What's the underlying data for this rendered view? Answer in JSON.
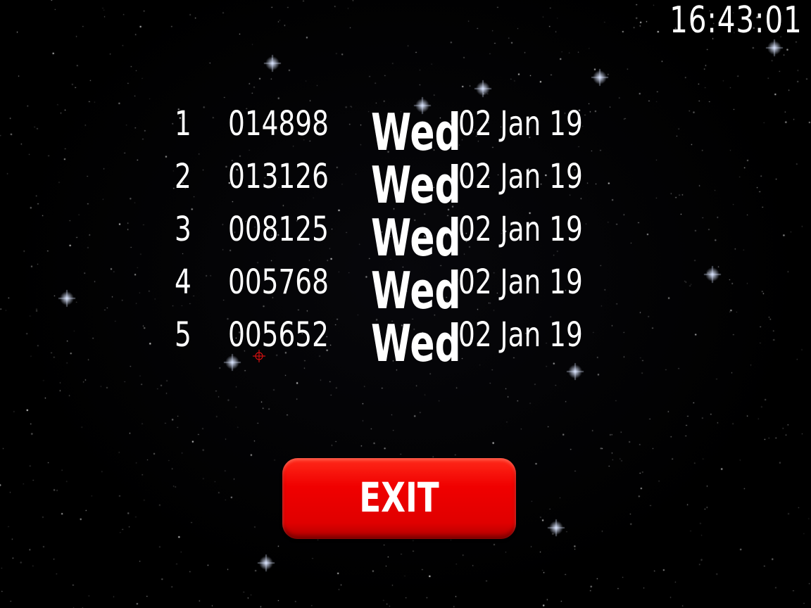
{
  "clock": "16:43:01",
  "high_scores": [
    {
      "rank": "1",
      "score": "014898",
      "day": "Wed",
      "date": "02 Jan 19"
    },
    {
      "rank": "2",
      "score": "013126",
      "day": "Wed",
      "date": "02 Jan 19"
    },
    {
      "rank": "3",
      "score": "008125",
      "day": "Wed",
      "date": "02 Jan 19"
    },
    {
      "rank": "4",
      "score": "005768",
      "day": "Wed",
      "date": "02 Jan 19"
    },
    {
      "rank": "5",
      "score": "005652",
      "day": "Wed",
      "date": "02 Jan 19"
    }
  ],
  "exit_button": {
    "label": "EXIT",
    "color": "#ff0000"
  },
  "cursor": {
    "icon": "crosshair-icon",
    "color": "#d01010"
  },
  "colors": {
    "background": "#000000",
    "text": "#ffffff"
  }
}
